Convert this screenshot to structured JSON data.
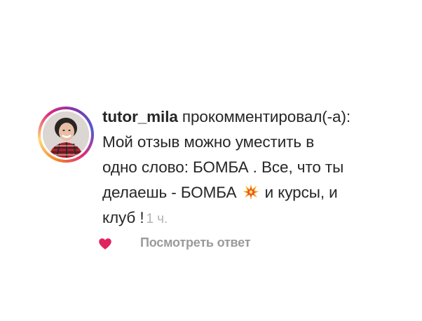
{
  "comment": {
    "username": "tutor_mila",
    "action_text": " прокомментировал(-а):",
    "text_line_1": "Мой отзыв можно уместить в",
    "text_line_2": "одно слово: БОМБА . Все, что ты",
    "text_line_3_before_emoji": "делаешь - БОМБА ",
    "text_line_3_after_emoji": " и курсы, и",
    "text_line_4": "клуб !",
    "timestamp": "1 ч.",
    "emoji_name": "collision-emoji"
  },
  "actions": {
    "like_icon": "heart-icon",
    "reply_label": "Посмотреть ответ"
  },
  "colors": {
    "text": "#262626",
    "muted": "#9a9a9a",
    "timestamp": "#b3b3b3",
    "heart": "#e0245e",
    "ring": [
      "#f58529",
      "#dd2a7b",
      "#8134af",
      "#515bd4"
    ]
  }
}
